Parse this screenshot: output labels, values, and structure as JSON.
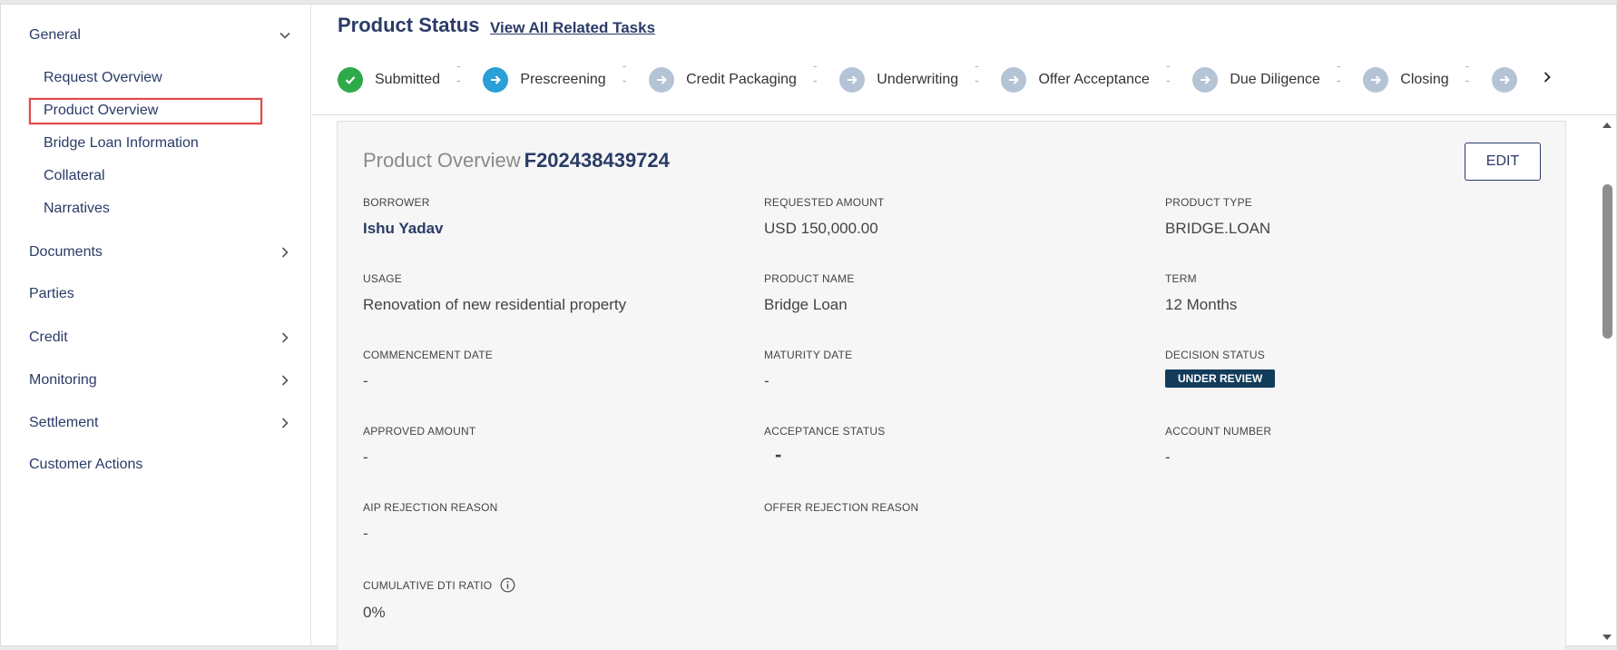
{
  "sidebar": {
    "groups": [
      {
        "label": "General"
      },
      {
        "label": "Documents"
      },
      {
        "label": "Parties"
      },
      {
        "label": "Credit"
      },
      {
        "label": "Monitoring"
      },
      {
        "label": "Settlement"
      },
      {
        "label": "Customer Actions"
      }
    ],
    "general_items": [
      {
        "label": "Request Overview"
      },
      {
        "label": "Product Overview"
      },
      {
        "label": "Bridge Loan Information"
      },
      {
        "label": "Collateral"
      },
      {
        "label": "Narratives"
      }
    ]
  },
  "header": {
    "title": "Product Status",
    "related_link": "View All Related Tasks",
    "steps": [
      {
        "label": "Submitted",
        "state": "done"
      },
      {
        "label": "Prescreening",
        "state": "active"
      },
      {
        "label": "Credit Packaging",
        "state": "pending"
      },
      {
        "label": "Underwriting",
        "state": "pending"
      },
      {
        "label": "Offer Acceptance",
        "state": "pending"
      },
      {
        "label": "Due Diligence",
        "state": "pending"
      },
      {
        "label": "Closing",
        "state": "pending"
      }
    ],
    "step_separator": "---"
  },
  "card": {
    "title": "Product Overview",
    "reference": "F202438439724",
    "edit_label": "EDIT",
    "fields": {
      "borrower": {
        "label": "BORROWER",
        "value": "Ishu Yadav"
      },
      "requested_amount": {
        "label": "REQUESTED AMOUNT",
        "value": "USD 150,000.00"
      },
      "product_type": {
        "label": "PRODUCT TYPE",
        "value": "BRIDGE.LOAN"
      },
      "usage": {
        "label": "USAGE",
        "value": "Renovation of new residential property"
      },
      "product_name": {
        "label": "PRODUCT NAME",
        "value": "Bridge Loan"
      },
      "term": {
        "label": "TERM",
        "value": "12 Months"
      },
      "commencement_date": {
        "label": "COMMENCEMENT DATE",
        "value": "-"
      },
      "maturity_date": {
        "label": "MATURITY DATE",
        "value": "-"
      },
      "decision_status": {
        "label": "DECISION STATUS",
        "value": "UNDER REVIEW"
      },
      "approved_amount": {
        "label": "APPROVED AMOUNT",
        "value": "-"
      },
      "acceptance_status": {
        "label": "ACCEPTANCE STATUS",
        "value": "-"
      },
      "account_number": {
        "label": "ACCOUNT NUMBER",
        "value": "-"
      },
      "aip_rejection_reason": {
        "label": "AIP REJECTION REASON",
        "value": "-"
      },
      "offer_rejection_reason": {
        "label": "OFFER REJECTION REASON",
        "value": ""
      },
      "cumulative_dti_ratio": {
        "label": "CUMULATIVE DTI RATIO",
        "value": "0%"
      }
    }
  },
  "colors": {
    "accent": "#2a3b66",
    "done": "#2eaa4a",
    "active": "#2a9fd8",
    "pending": "#b4c3d6",
    "badge": "#123c5a",
    "highlight": "#e04a4a"
  },
  "icons": {
    "expand": "chevron-down-icon",
    "collapsed": "chevron-right-icon",
    "done": "check-icon",
    "step": "arrow-right-icon",
    "info": "info-icon"
  }
}
